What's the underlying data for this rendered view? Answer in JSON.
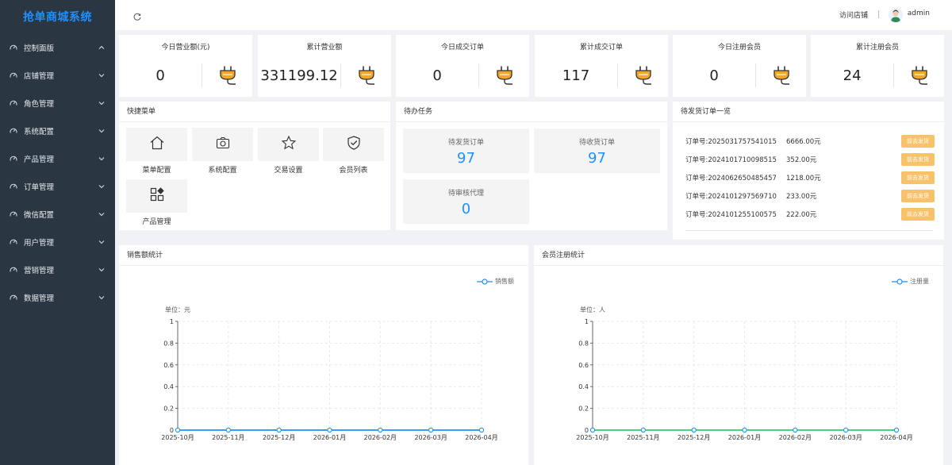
{
  "app": {
    "brand": "抢单商城系统"
  },
  "sidebar": {
    "items": [
      {
        "label": "控制面版",
        "expanded": true
      },
      {
        "label": "店铺管理",
        "expanded": false
      },
      {
        "label": "角色管理",
        "expanded": false
      },
      {
        "label": "系统配置",
        "expanded": false
      },
      {
        "label": "产品管理",
        "expanded": false
      },
      {
        "label": "订单管理",
        "expanded": false
      },
      {
        "label": "微信配置",
        "expanded": false
      },
      {
        "label": "用户管理",
        "expanded": false
      },
      {
        "label": "营销管理",
        "expanded": false
      },
      {
        "label": "数据管理",
        "expanded": false
      }
    ]
  },
  "header": {
    "visit_label": "访问店铺",
    "user": "admin"
  },
  "stats": [
    {
      "title": "今日营业额(元)",
      "value": "0"
    },
    {
      "title": "累计营业额",
      "value": "331199.12"
    },
    {
      "title": "今日成交订单",
      "value": "0"
    },
    {
      "title": "累计成交订单",
      "value": "117"
    },
    {
      "title": "今日注册会员",
      "value": "0"
    },
    {
      "title": "累计注册会员",
      "value": "24"
    }
  ],
  "quick_menu": {
    "title": "快捷菜单",
    "items": [
      {
        "label": "菜单配置",
        "icon": "home-icon"
      },
      {
        "label": "系统配置",
        "icon": "camera-icon"
      },
      {
        "label": "交易设置",
        "icon": "star-icon"
      },
      {
        "label": "会员列表",
        "icon": "shield-check-icon"
      },
      {
        "label": "产品管理",
        "icon": "apps-icon"
      }
    ]
  },
  "tasks": {
    "title": "待办任务",
    "items": [
      {
        "label": "待发货订单",
        "value": "97"
      },
      {
        "label": "待收货订单",
        "value": "97"
      },
      {
        "label": "待审核代理",
        "value": "0"
      }
    ]
  },
  "pending_orders": {
    "title": "待发货订单一览",
    "button_label": "前去发货",
    "rows": [
      {
        "order_no": "订单号:2025031757541015",
        "amount": "6666.00元"
      },
      {
        "order_no": "订单号:2024101710098515",
        "amount": "352.00元"
      },
      {
        "order_no": "订单号:2024062650485457",
        "amount": "1218.00元"
      },
      {
        "order_no": "订单号:2024101297569710",
        "amount": "233.00元"
      },
      {
        "order_no": "订单号:2024101255100575",
        "amount": "222.00元"
      }
    ]
  },
  "colors": {
    "accent": "#1e90ff",
    "sidebar_bg": "#2b3643",
    "button": "#f8c26a",
    "plug": "#f5a623",
    "line_sales": "#1e90ff",
    "line_members": "#2ecc71"
  },
  "chart_data": [
    {
      "type": "line",
      "panel_title": "销售额统计",
      "unit_label": "单位：元",
      "categories": [
        "2025-10月",
        "2025-11月",
        "2025-12月",
        "2026-01月",
        "2026-02月",
        "2026-03月",
        "2026-04月"
      ],
      "series": [
        {
          "name": "销售额",
          "values": [
            0,
            0,
            0,
            0,
            0,
            0,
            0
          ]
        }
      ],
      "ylim": [
        0,
        1
      ],
      "yticks": [
        "0",
        "0.2",
        "0.4",
        "0.6",
        "0.8",
        "1"
      ],
      "legend": "top-right",
      "grid": true
    },
    {
      "type": "line",
      "panel_title": "会员注册统计",
      "unit_label": "单位：人",
      "categories": [
        "2025-10月",
        "2025-11月",
        "2025-12月",
        "2026-01月",
        "2026-02月",
        "2026-03月",
        "2026-04月"
      ],
      "series": [
        {
          "name": "注册量",
          "values": [
            0,
            0,
            0,
            0,
            0,
            0,
            0
          ]
        }
      ],
      "ylim": [
        0,
        1
      ],
      "yticks": [
        "0",
        "0.2",
        "0.4",
        "0.6",
        "0.8",
        "1"
      ],
      "legend": "top-right",
      "grid": true
    }
  ]
}
